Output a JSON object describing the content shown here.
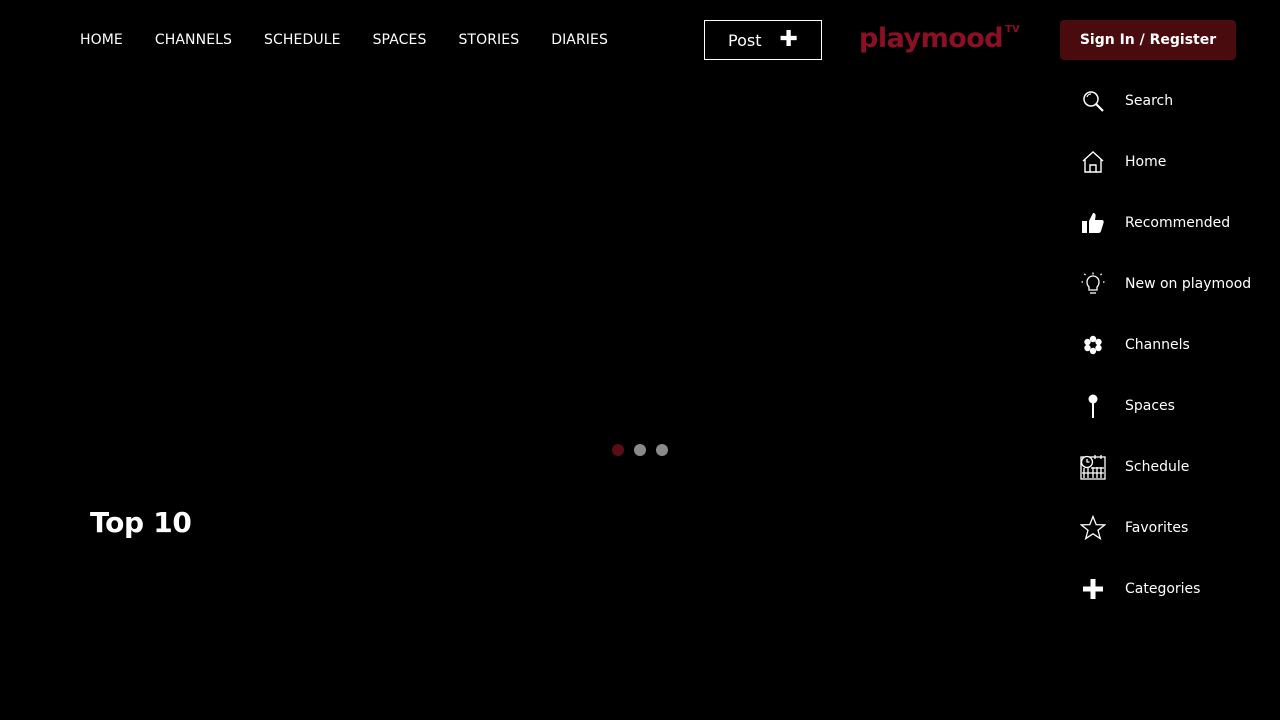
{
  "nav": {
    "items": [
      "HOME",
      "CHANNELS",
      "SCHEDULE",
      "SPACES",
      "STORIES",
      "DIARIES"
    ]
  },
  "post_button": {
    "label": "Post"
  },
  "logo": {
    "text": "playmood",
    "superscript": "TV"
  },
  "auth": {
    "signin_label": "Sign In / Register"
  },
  "sidemenu": {
    "items": [
      {
        "label": "Search",
        "icon": "search-icon"
      },
      {
        "label": "Home",
        "icon": "home-icon"
      },
      {
        "label": "Recommended",
        "icon": "thumbs-up-icon"
      },
      {
        "label": "New on playmood",
        "icon": "lightbulb-icon"
      },
      {
        "label": "Channels",
        "icon": "snowflake-icon"
      },
      {
        "label": "Spaces",
        "icon": "pin-icon"
      },
      {
        "label": "Schedule",
        "icon": "calendar-clock-icon"
      },
      {
        "label": "Favorites",
        "icon": "star-icon"
      },
      {
        "label": "Categories",
        "icon": "plus-icon"
      }
    ]
  },
  "carousel": {
    "slide_count": 3,
    "active_index": 0,
    "active_color": "#5a0d14",
    "inactive_color": "#8a8a8a"
  },
  "section": {
    "title": "Top 10"
  },
  "colors": {
    "background": "#000000",
    "brand": "#8b1023",
    "signin_bg": "#4a0b0f"
  }
}
